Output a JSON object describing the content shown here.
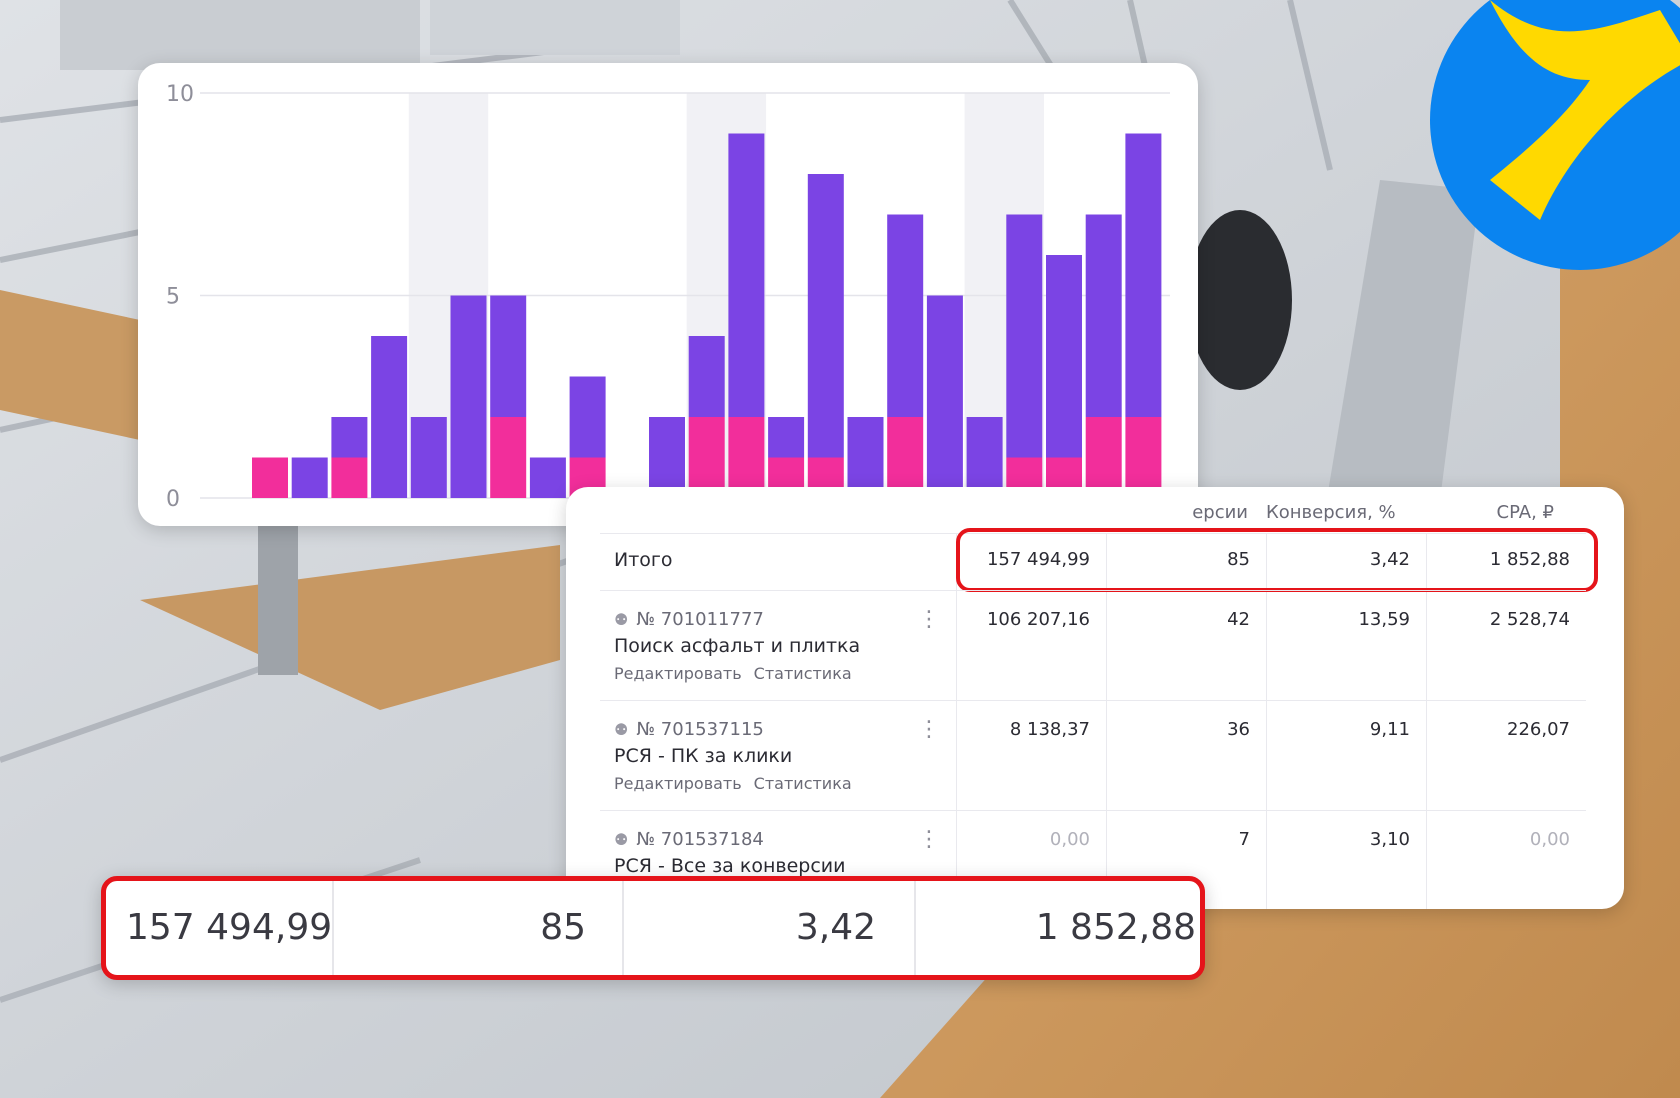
{
  "colors": {
    "purple": "#7b44e4",
    "pink": "#f22e9b",
    "highlight_red": "#e5141a",
    "logo_blue": "#0a84f0",
    "logo_yellow": "#ffd900"
  },
  "logo": {
    "icon": "yandex-direct-logo-icon"
  },
  "chart_data": {
    "type": "bar",
    "stacked": true,
    "title": "",
    "xlabel": "",
    "ylabel": "",
    "ylim": [
      0,
      10
    ],
    "yticks": [
      "0",
      "5",
      "10"
    ],
    "grid": true,
    "x": [
      1,
      2,
      3,
      4,
      5,
      6,
      7,
      8,
      9,
      10,
      11,
      12,
      13,
      14,
      15,
      16,
      17,
      18,
      19,
      20,
      21,
      22,
      23,
      24
    ],
    "series": [
      {
        "color": "#f22e9b",
        "values": [
          1,
          0,
          1,
          0,
          0,
          0,
          2,
          0,
          1,
          0,
          2,
          2,
          1,
          1,
          0,
          2,
          0,
          0,
          1,
          1,
          2,
          2
        ]
      },
      {
        "color": "#7b44e4",
        "values": [
          0,
          1,
          1,
          4,
          2,
          5,
          3,
          1,
          2,
          2,
          2,
          7,
          1,
          7,
          2,
          5,
          5,
          2,
          6,
          5,
          5,
          7
        ]
      }
    ],
    "bar_slots": [
      0,
      1,
      2,
      3,
      4,
      5,
      6,
      7,
      8,
      10,
      11,
      12,
      13,
      14,
      15,
      16,
      17,
      18,
      19,
      20,
      21,
      22
    ],
    "shaded_bands": [
      [
        4,
        5
      ],
      [
        11,
        12
      ],
      [
        18,
        19
      ]
    ]
  },
  "table": {
    "headers": {
      "conversions": "ерсии",
      "conversion_rate": "Конверсия, %",
      "cpa": "CPA, ₽"
    },
    "total": {
      "label": "Итого",
      "cost": "157 494,99",
      "conversions": "85",
      "conversion_rate": "3,42",
      "cpa": "1 852,88"
    },
    "campaigns": [
      {
        "id": "№ 701011777",
        "name": "Поиск асфальт и плитка",
        "edit": "Редактировать",
        "stats": "Статистика",
        "cost": "106 207,16",
        "conversions": "42",
        "conversion_rate": "13,59",
        "cpa": "2 528,74"
      },
      {
        "id": "№ 701537115",
        "name": "РСЯ - ПК за клики",
        "edit": "Редактировать",
        "stats": "Статистика",
        "cost": "8 138,37",
        "conversions": "36",
        "conversion_rate": "9,11",
        "cpa": "226,07"
      },
      {
        "id": "№ 701537184",
        "name": "РСЯ - Все за конверсии",
        "cost": "0,00",
        "conversions": "7",
        "conversion_rate": "3,10",
        "cpa": "0,00"
      }
    ]
  },
  "zoom": {
    "cost": "157 494,99",
    "conversions": "85",
    "conversion_rate": "3,42",
    "cpa": "1 852,88"
  }
}
